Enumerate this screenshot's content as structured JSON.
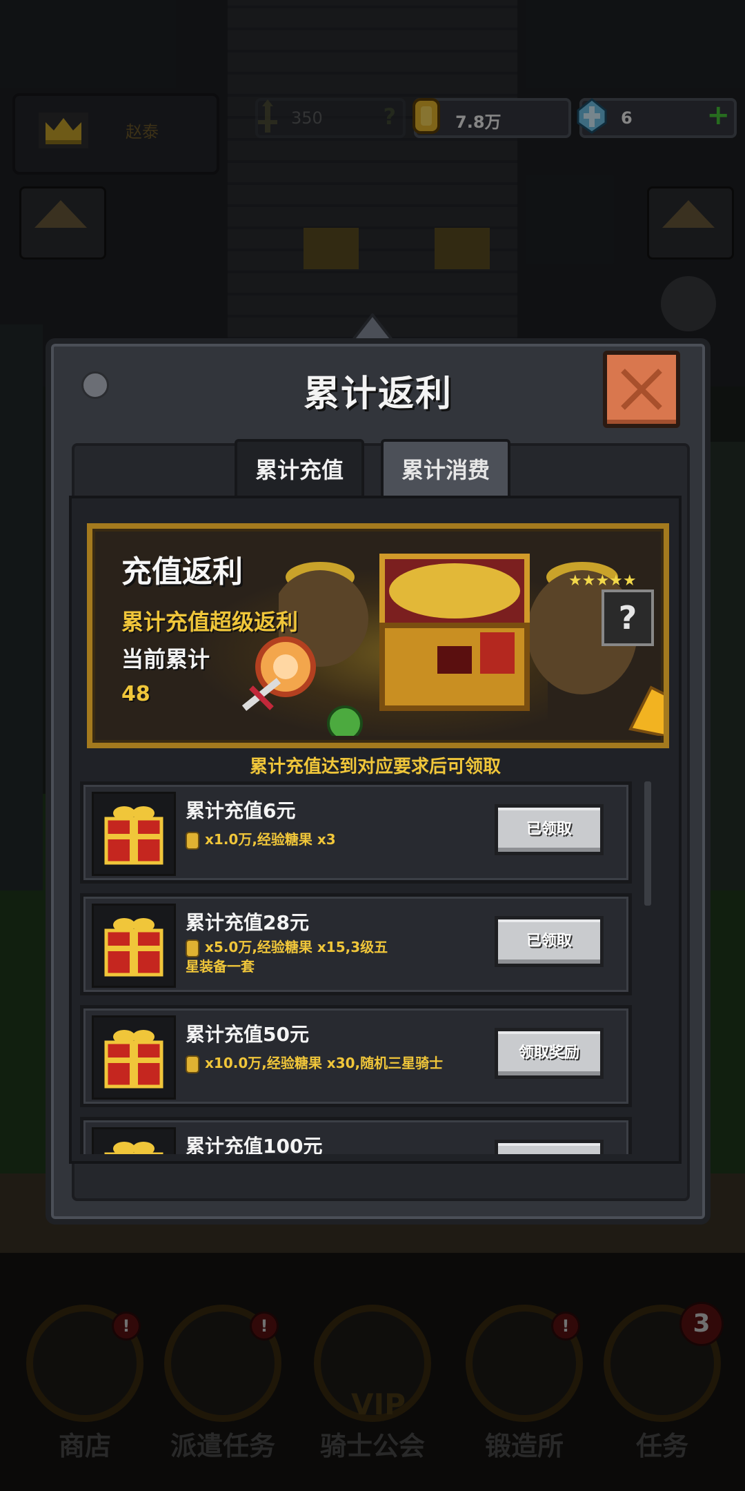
{
  "hud": {
    "player_name": "赵泰",
    "power": "350",
    "gold": "7.8万",
    "gems": "6"
  },
  "modal": {
    "title": "累计返利",
    "tabs": [
      {
        "label": "累计充值",
        "active": true
      },
      {
        "label": "累计消费",
        "active": false
      }
    ],
    "banner": {
      "title": "充值返利",
      "subtitle": "累计充值超级返利",
      "current_label": "当前累计",
      "current_value": "48"
    },
    "hint": "累计充值达到对应要求后可领取",
    "rewards": [
      {
        "title": "累计充值6元",
        "reward": "x1.0万,经验糖果 x3",
        "button": "已领取"
      },
      {
        "title": "累计充值28元",
        "reward": "x5.0万,经验糖果 x15,3级五星装备一套",
        "button": "已领取"
      },
      {
        "title": "累计充值50元",
        "reward": "x10.0万,经验糖果 x30,随机三星骑士",
        "button": "领取奖励"
      },
      {
        "title": "累计充值100元",
        "reward": "",
        "button": ""
      }
    ]
  },
  "nav": {
    "items": [
      {
        "label": "商店",
        "badge": "!"
      },
      {
        "label": "派遣任务",
        "badge": "!"
      },
      {
        "label": "骑士公会",
        "badge": ""
      },
      {
        "label": "锻造所",
        "badge": "!"
      },
      {
        "label": "任务",
        "badge": "3"
      }
    ],
    "vip_text": "VIP"
  },
  "colors": {
    "accent_gold": "#f0c63a",
    "close_orange": "#d9774e",
    "panel": "#32353b",
    "plus_green": "#47c53a"
  }
}
